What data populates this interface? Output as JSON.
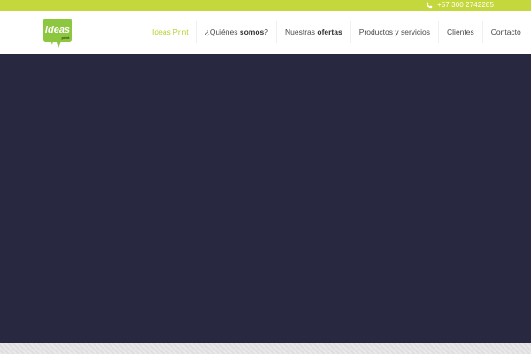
{
  "topbar": {
    "phone_icon": "phone-icon",
    "phone": "+57 300 2742285",
    "color": "#c4d73c"
  },
  "logo": {
    "text": "ideas",
    "subtext": "print",
    "color": "#8dc63f"
  },
  "nav": {
    "items": [
      {
        "label": "Ideas Print",
        "active": true
      },
      {
        "label_pre": "¿Quiénes ",
        "label_bold": "somos",
        "label_post": "?"
      },
      {
        "label_pre": "Nuestras ",
        "label_bold": "ofertas"
      },
      {
        "label": "Productos y servicios"
      },
      {
        "label": "Clientes"
      },
      {
        "label": "Contacto"
      }
    ]
  },
  "hero": {
    "background": "#282941"
  }
}
